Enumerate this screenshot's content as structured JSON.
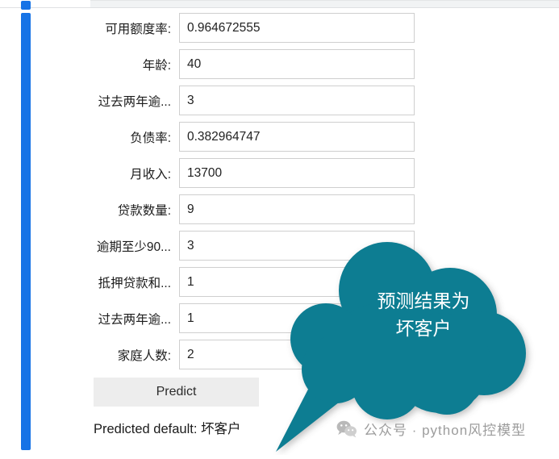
{
  "colors": {
    "accent_teal": "#0a7d92",
    "scrollbar_blue": "#1673e6",
    "button_gray": "#ededed",
    "input_border": "#cfcfcf",
    "watermark_gray": "#9c9c9c"
  },
  "browser": {
    "tab_label": ""
  },
  "form": {
    "fields": [
      {
        "label": "可用额度率:",
        "value": "0.964672555",
        "placeholder": ""
      },
      {
        "label": "年龄:",
        "value": "40",
        "placeholder": ""
      },
      {
        "label": "过去两年逾...",
        "value": "3",
        "placeholder": ""
      },
      {
        "label": "负债率:",
        "value": "0.382964747",
        "placeholder": ""
      },
      {
        "label": "月收入:",
        "value": "13700",
        "placeholder": ""
      },
      {
        "label": "贷款数量:",
        "value": "9",
        "placeholder": ""
      },
      {
        "label": "逾期至少90...",
        "value": "3",
        "placeholder": ""
      },
      {
        "label": "抵押贷款和...",
        "value": "1",
        "placeholder": ""
      },
      {
        "label": "过去两年逾...",
        "value": "1",
        "placeholder": ""
      },
      {
        "label": "家庭人数:",
        "value": "2",
        "placeholder": ""
      }
    ],
    "predict_button_label": "Predict",
    "result_text": "Predicted default: 坏客户"
  },
  "callout": {
    "text": "预测结果为\n坏客户"
  },
  "watermark": {
    "icon": "wechat-icon",
    "text": "公众号 · python风控模型"
  }
}
